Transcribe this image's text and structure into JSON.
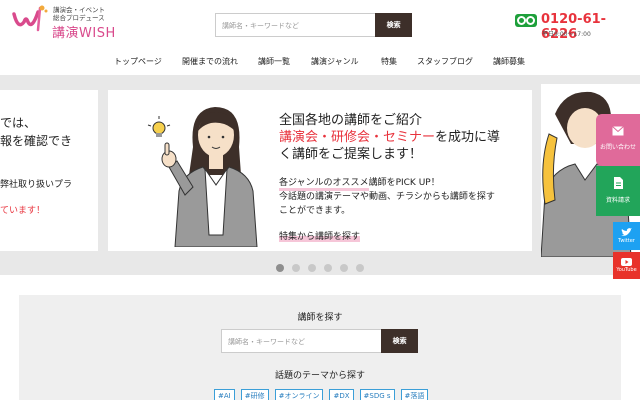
{
  "header": {
    "logo_sub_line1": "講演会・イベント",
    "logo_sub_line2": "総合プロデュース",
    "logo_name": "講演WISH",
    "search_placeholder": "講師名・キーワードなど",
    "search_button": "検索",
    "phone_number": "0120-61-6226",
    "phone_hours": "平日9:00〜17:00"
  },
  "nav": {
    "items": [
      "トップページ",
      "開催までの流れ",
      "講師一覧",
      "講演ジャンル",
      "特集",
      "スタッフブログ",
      "講師募集"
    ]
  },
  "slider": {
    "left_lines": [
      "では、",
      "報を確認でき",
      "弊社取り扱いプラ",
      "ています！"
    ],
    "title_line1": "全国各地の講師をご紹介",
    "title_line2_pink": "講演会・研修会・セミナー",
    "title_line2_rest": "を成功に導",
    "title_line3": "く講師をご提案します！",
    "pick_prefix": "各ジャンルのオススメ",
    "pick_highlight": "講師をPICK UP！",
    "desc_line1": "今話題の講演テーマや動画、チラシからも講師を探す",
    "desc_line2": "ことができます。",
    "link": "特集から講師を探す",
    "dot_count": 6,
    "active_dot": 0
  },
  "side_buttons": {
    "contact": "お問い合わせ",
    "request": "資料請求",
    "twitter": "Twitter",
    "youtube": "YouTube"
  },
  "lecturer_search": {
    "title": "講師を探す",
    "placeholder": "講師名・キーワードなど",
    "button": "検索"
  },
  "topics": {
    "title": "話題のテーマから探す",
    "tags": [
      "#AI",
      "#研修",
      "#オンライン",
      "#DX",
      "#SDG s",
      "#落語"
    ]
  },
  "colors": {
    "brand_pink": "#d94a8c",
    "red": "#e8323c",
    "button_dark": "#3d2f29",
    "twitter_blue": "#1da1f2",
    "youtube_red": "#e8322a",
    "phone_green": "#1ea03b"
  }
}
